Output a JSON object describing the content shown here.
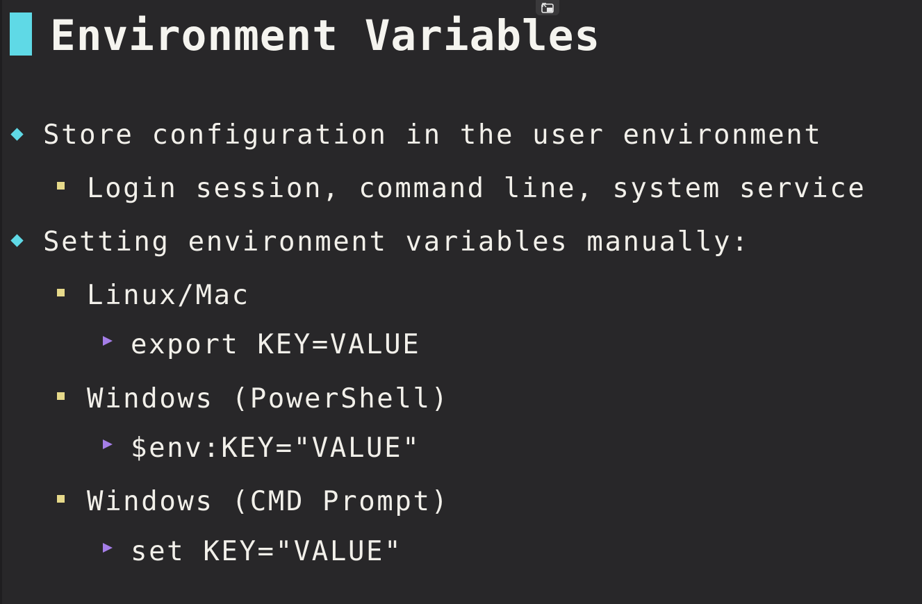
{
  "slide": {
    "title": "Environment Variables",
    "items": [
      {
        "level": 1,
        "text": "Store configuration in the user environment"
      },
      {
        "level": 2,
        "text": "Login session, command line, system service"
      },
      {
        "level": 1,
        "text": "Setting environment variables manually:"
      },
      {
        "level": 2,
        "text": "Linux/Mac"
      },
      {
        "level": 3,
        "text": "export KEY=VALUE"
      },
      {
        "level": 2,
        "text": "Windows (PowerShell)"
      },
      {
        "level": 3,
        "text": "$env:KEY=\"VALUE\""
      },
      {
        "level": 2,
        "text": "Windows (CMD Prompt)"
      },
      {
        "level": 3,
        "text": "set KEY=\"VALUE\""
      }
    ]
  },
  "colors": {
    "background": "#282729",
    "accent_cyan": "#5fd9e6",
    "bullet_yellow": "#e6d98a",
    "bullet_purple": "#a57ee8",
    "text": "#f2f0ea"
  },
  "icons": {
    "overlay": "picture-in-picture-icon"
  }
}
